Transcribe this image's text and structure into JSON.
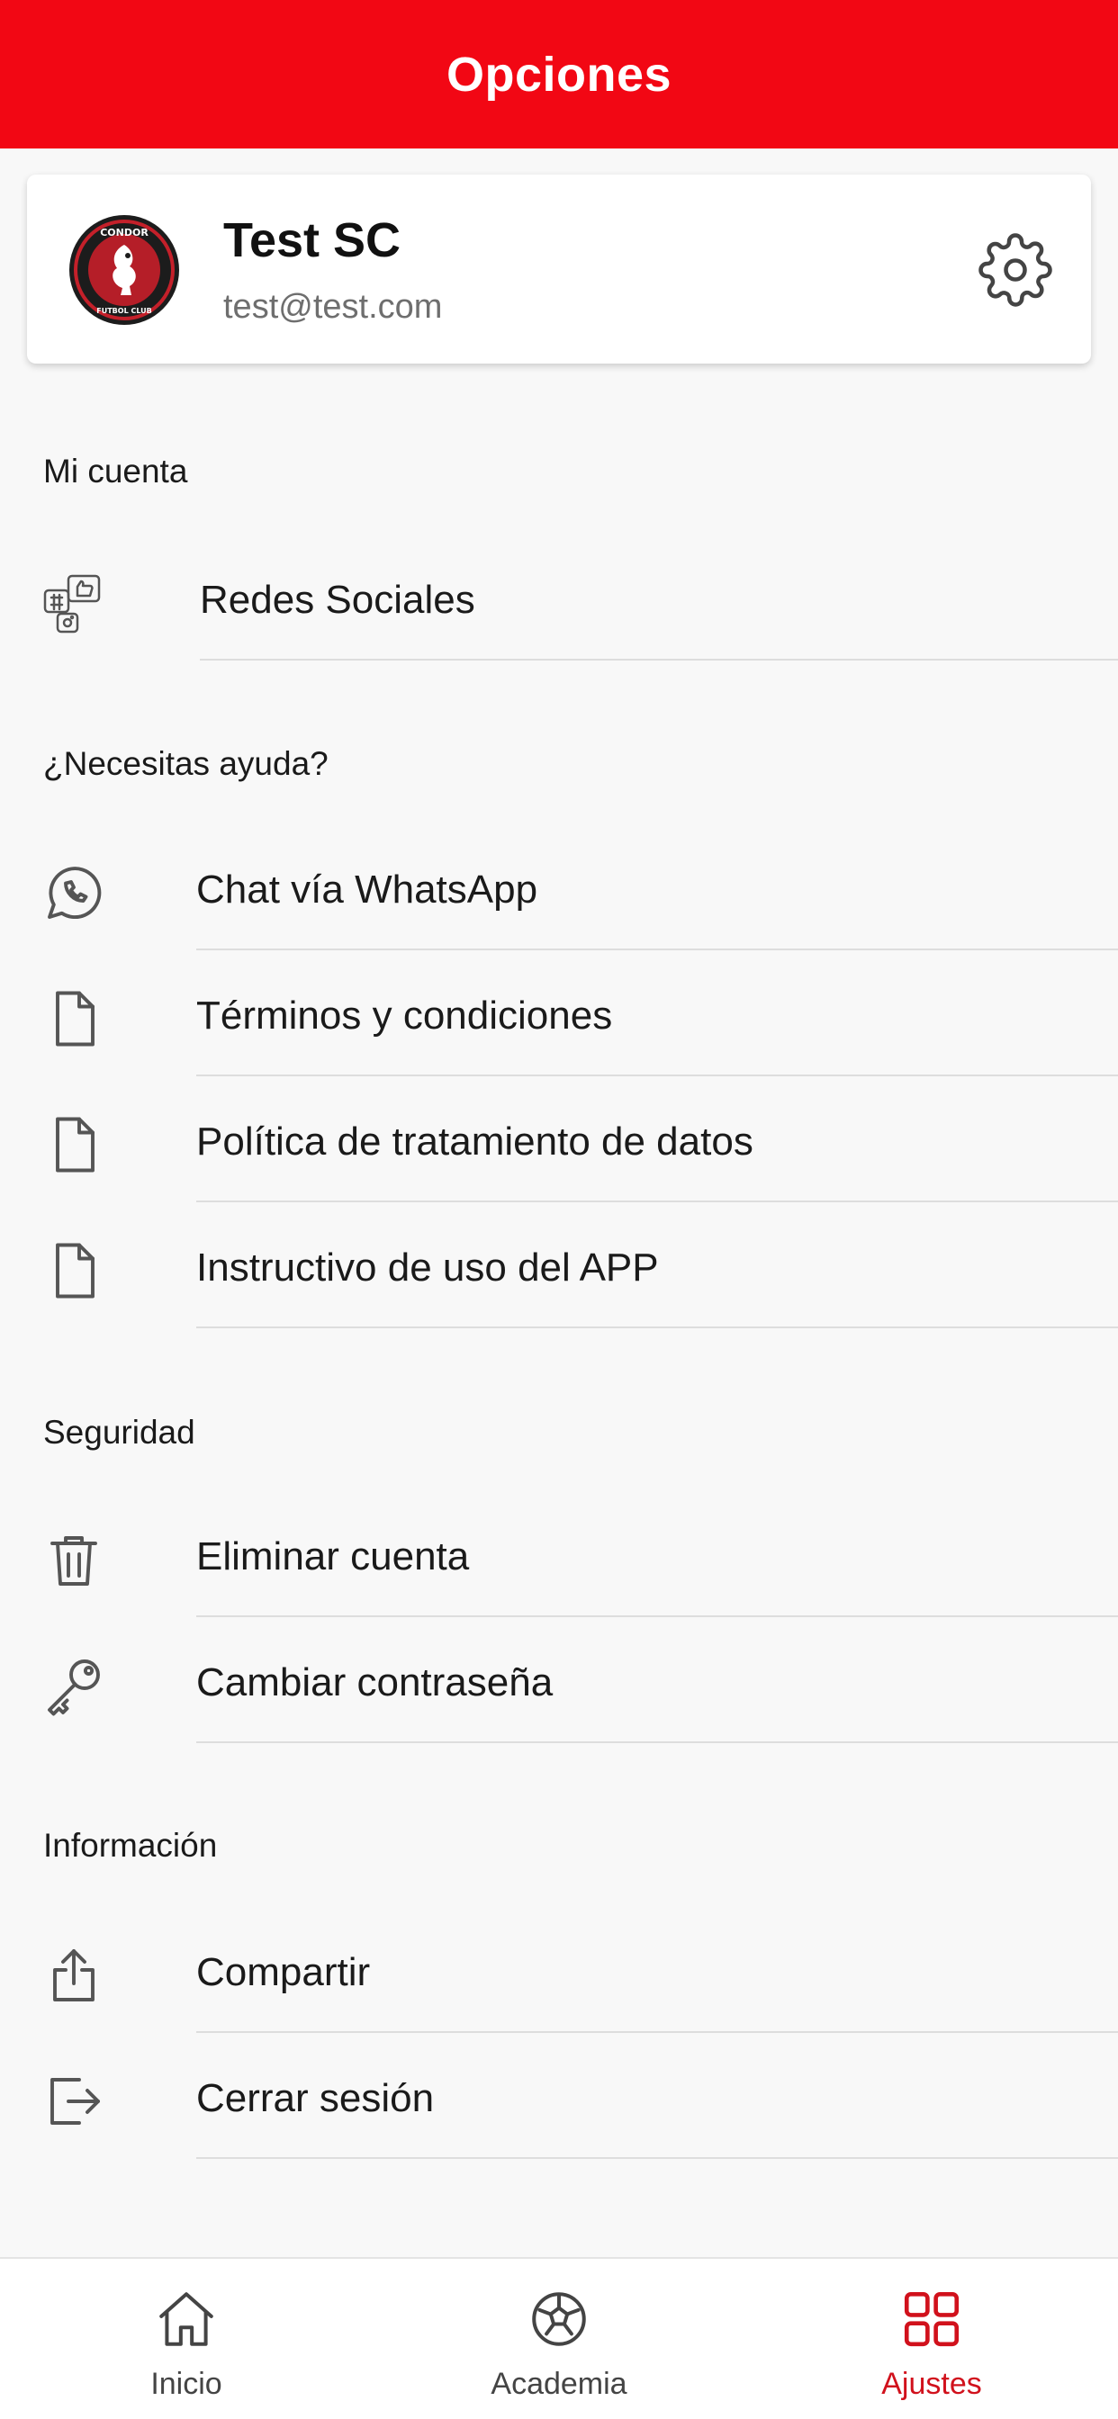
{
  "header": {
    "title": "Opciones"
  },
  "profile": {
    "name": "Test SC",
    "email": "test@test.com",
    "logo_text_top": "CONDOR",
    "logo_text_bottom": "FUTBOL CLUB"
  },
  "sections": {
    "account": {
      "title": "Mi cuenta",
      "items": [
        {
          "label": "Redes Sociales",
          "icon": "social-networks-icon"
        }
      ]
    },
    "help": {
      "title": "¿Necesitas ayuda?",
      "items": [
        {
          "label": "Chat vía WhatsApp",
          "icon": "whatsapp-icon"
        },
        {
          "label": "Términos y condiciones",
          "icon": "document-icon"
        },
        {
          "label": "Política de tratamiento de datos",
          "icon": "document-icon"
        },
        {
          "label": "Instructivo de uso del APP",
          "icon": "document-icon"
        }
      ]
    },
    "security": {
      "title": "Seguridad",
      "items": [
        {
          "label": "Eliminar cuenta",
          "icon": "trash-icon"
        },
        {
          "label": "Cambiar contraseña",
          "icon": "key-icon"
        }
      ]
    },
    "info": {
      "title": "Información",
      "items": [
        {
          "label": "Compartir",
          "icon": "share-icon"
        },
        {
          "label": "Cerrar sesión",
          "icon": "logout-icon"
        }
      ]
    }
  },
  "bottom_nav": {
    "items": [
      {
        "label": "Inicio",
        "icon": "home-icon"
      },
      {
        "label": "Academia",
        "icon": "soccer-ball-icon"
      },
      {
        "label": "Ajustes",
        "icon": "grid-icon"
      }
    ],
    "active_index": 2
  },
  "colors": {
    "brand_red": "#f20714",
    "active_nav": "#d1111c",
    "text": "#1a1a1a",
    "muted": "#6e6e6e",
    "divider": "#dddddd"
  }
}
